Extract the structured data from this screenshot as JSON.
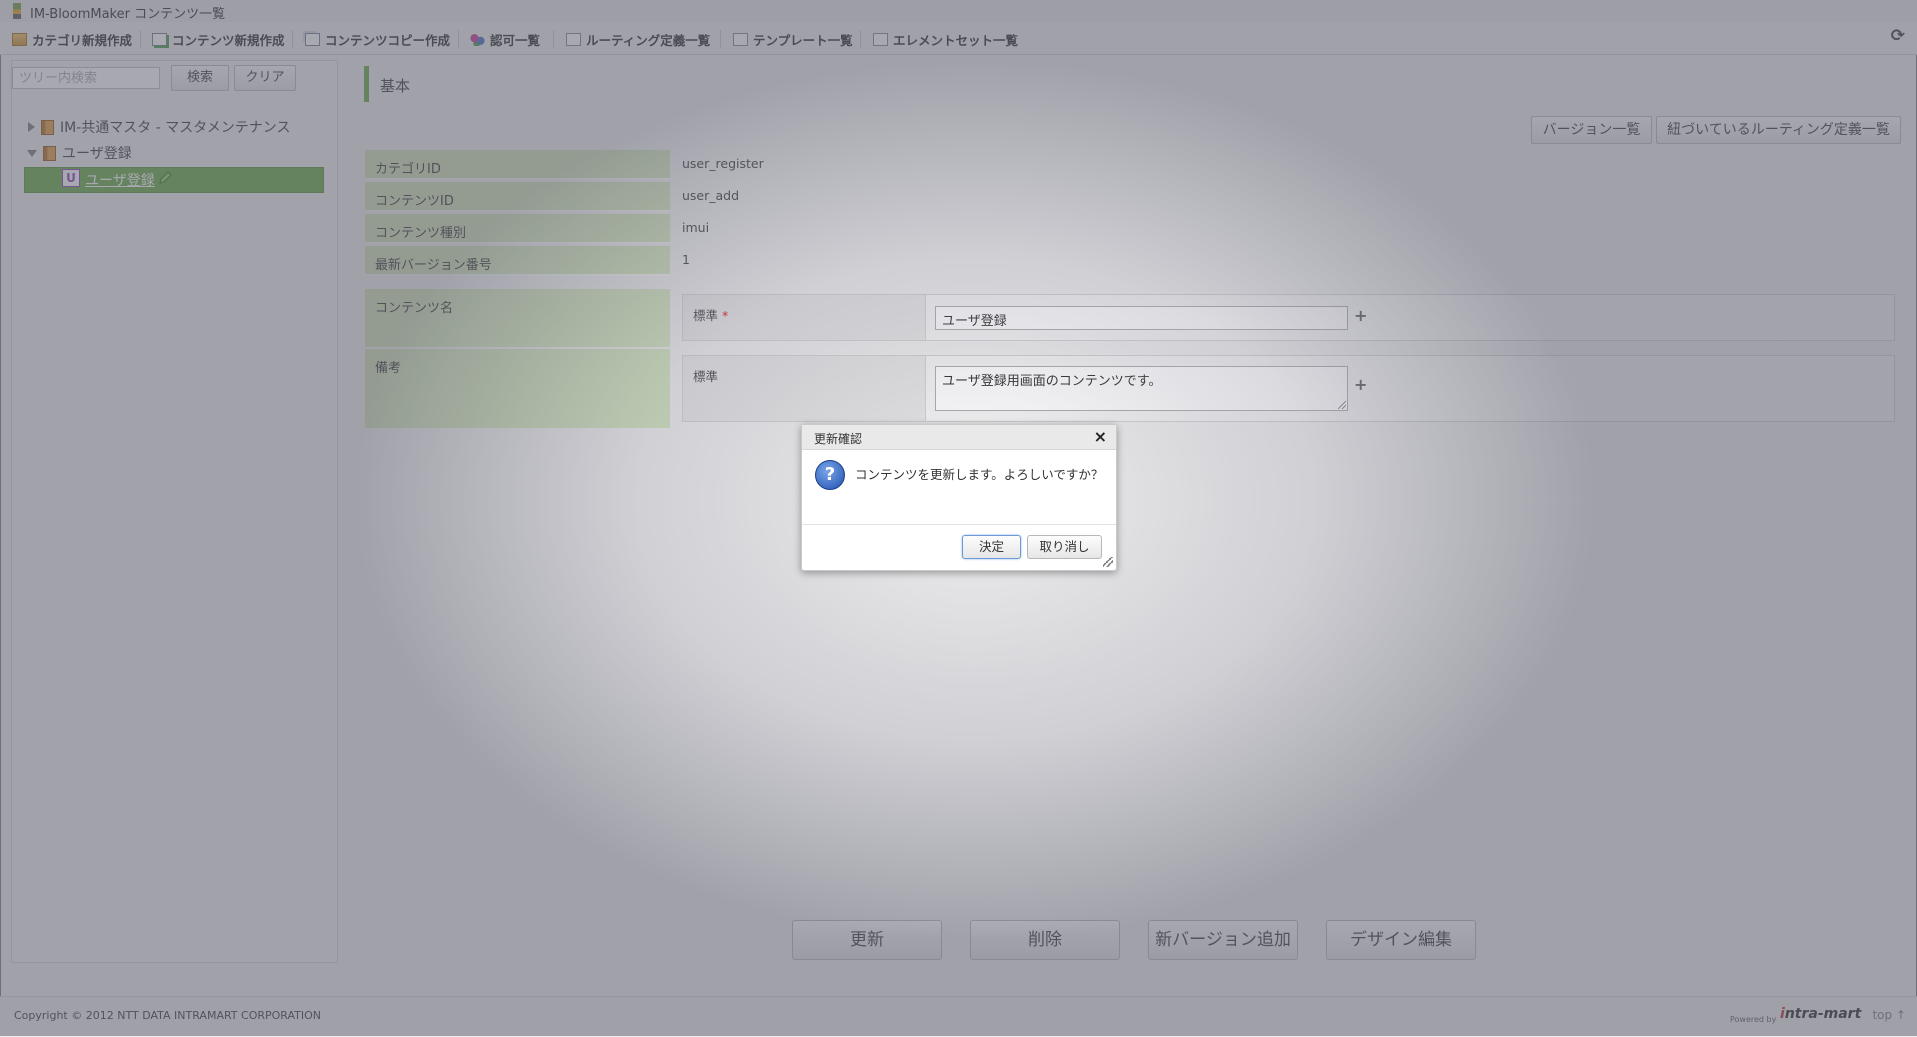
{
  "window": {
    "title": "IM-BloomMaker コンテンツ一覧"
  },
  "toolbar": {
    "items": [
      {
        "label": "カテゴリ新規作成",
        "icon": "folder-new-icon"
      },
      {
        "label": "コンテンツ新規作成",
        "icon": "document-new-icon"
      },
      {
        "label": "コンテンツコピー作成",
        "icon": "copy-icon"
      },
      {
        "label": "認可一覧",
        "icon": "permission-icon"
      },
      {
        "label": "ルーティング定義一覧",
        "icon": "list-icon"
      },
      {
        "label": "テンプレート一覧",
        "icon": "list-icon"
      },
      {
        "label": "エレメントセット一覧",
        "icon": "list-icon"
      }
    ],
    "refresh_icon": "refresh-icon"
  },
  "tree": {
    "search_placeholder": "ツリー内検索",
    "search_button": "検索",
    "clear_button": "クリア",
    "nodes": [
      {
        "label": "IM-共通マスタ - マスタメンテナンス",
        "expanded": false
      },
      {
        "label": "ユーザ登録",
        "expanded": true
      },
      {
        "label": "ユーザ登録",
        "type_badge": "U",
        "selected": true
      }
    ]
  },
  "section": {
    "title": "基本"
  },
  "header_buttons": {
    "versions": "バージョン一覧",
    "linked_routing": "紐づいているルーティング定義一覧"
  },
  "info": [
    {
      "label": "カテゴリID",
      "value": "user_register"
    },
    {
      "label": "コンテンツID",
      "value": "user_add"
    },
    {
      "label": "コンテンツ種別",
      "value": "imui"
    },
    {
      "label": "最新バージョン番号",
      "value": "1"
    }
  ],
  "content_name": {
    "label": "コンテンツ名",
    "sub_label": "標準",
    "required_mark": "*",
    "value": "ユーザ登録"
  },
  "remarks": {
    "label": "備考",
    "sub_label": "標準",
    "value": "ユーザ登録用画面のコンテンツです。"
  },
  "actions": {
    "update": "更新",
    "delete": "削除",
    "add_version": "新バージョン追加",
    "design_edit": "デザイン編集"
  },
  "footer": {
    "copyright": "Copyright © 2012 NTT DATA INTRAMART CORPORATION",
    "powered_by": "Powered by",
    "logo": {
      "mark": "i",
      "text": "ntra-mart"
    },
    "top_link": "top ↑"
  },
  "dialog": {
    "title": "更新確認",
    "message": "コンテンツを更新します。よろしいですか？",
    "ok": "決定",
    "cancel": "取り消し",
    "icon": "question-icon"
  }
}
